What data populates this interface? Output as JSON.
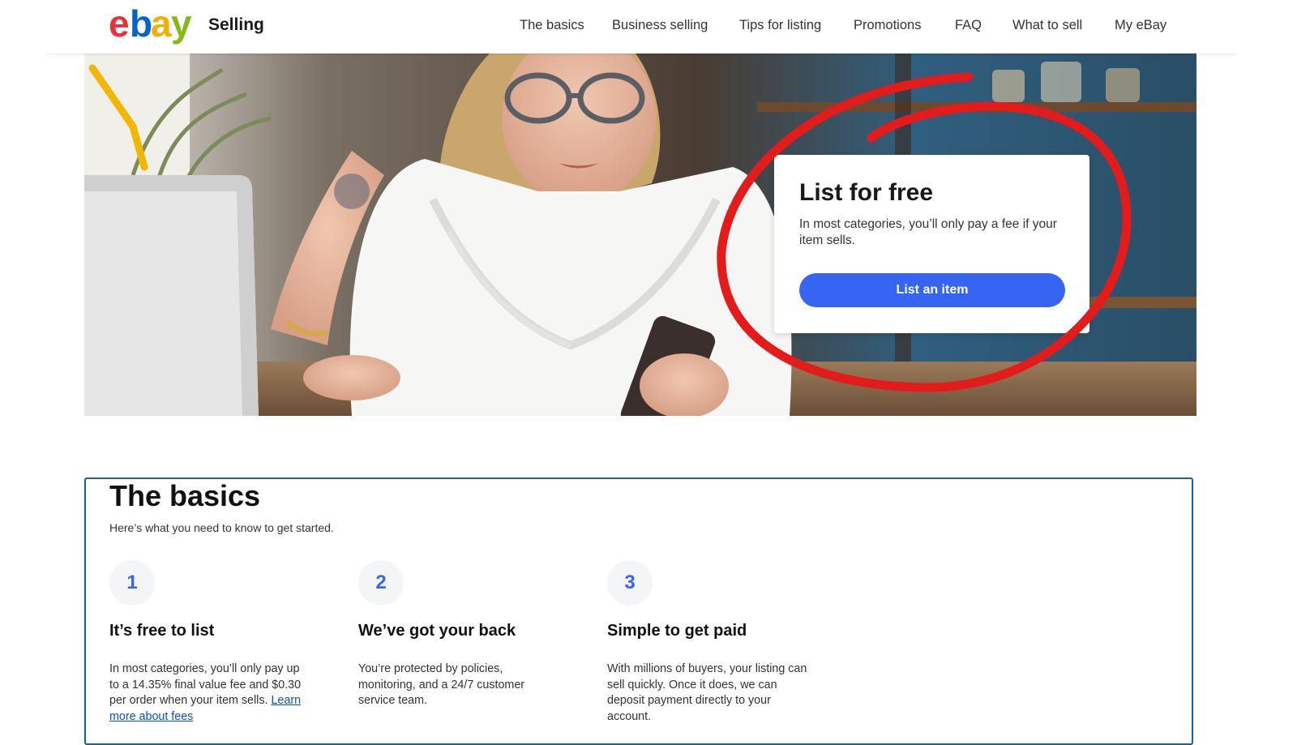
{
  "header": {
    "logo_text": "ebay",
    "section_label": "Selling",
    "nav": [
      {
        "label": "The basics"
      },
      {
        "label": "Business selling"
      },
      {
        "label": "Tips for listing"
      },
      {
        "label": "Promotions"
      },
      {
        "label": "FAQ"
      },
      {
        "label": "What to sell"
      },
      {
        "label": "My eBay"
      }
    ]
  },
  "hero": {
    "card_title": "List for free",
    "card_text": "In most categories, you’ll only pay a fee if your item sells.",
    "button_label": "List an item"
  },
  "basics": {
    "title": "The basics",
    "subtitle": "Here’s what you need to know to get started.",
    "steps": [
      {
        "number": "1",
        "title": "It’s free to list",
        "text": "In most categories, you’ll only pay up to a 14.35% final value fee and $0.30 per order when your item sells.",
        "link": "Learn more about fees"
      },
      {
        "number": "2",
        "title": "We’ve got your back",
        "text": "You’re protected by policies, monitoring, and a 24/7 customer service team."
      },
      {
        "number": "3",
        "title": "Simple to get paid",
        "text": "With millions of buyers, your listing can sell quickly. Once it does, we can deposit payment directly to your account."
      }
    ]
  },
  "colors": {
    "ebay_e": "#e53238",
    "ebay_b": "#0064d2",
    "ebay_a": "#f5af02",
    "ebay_y": "#86b817",
    "primary_button": "#3665f3",
    "annotation_red": "#e41b1b",
    "section_border": "#1b5fa8"
  }
}
